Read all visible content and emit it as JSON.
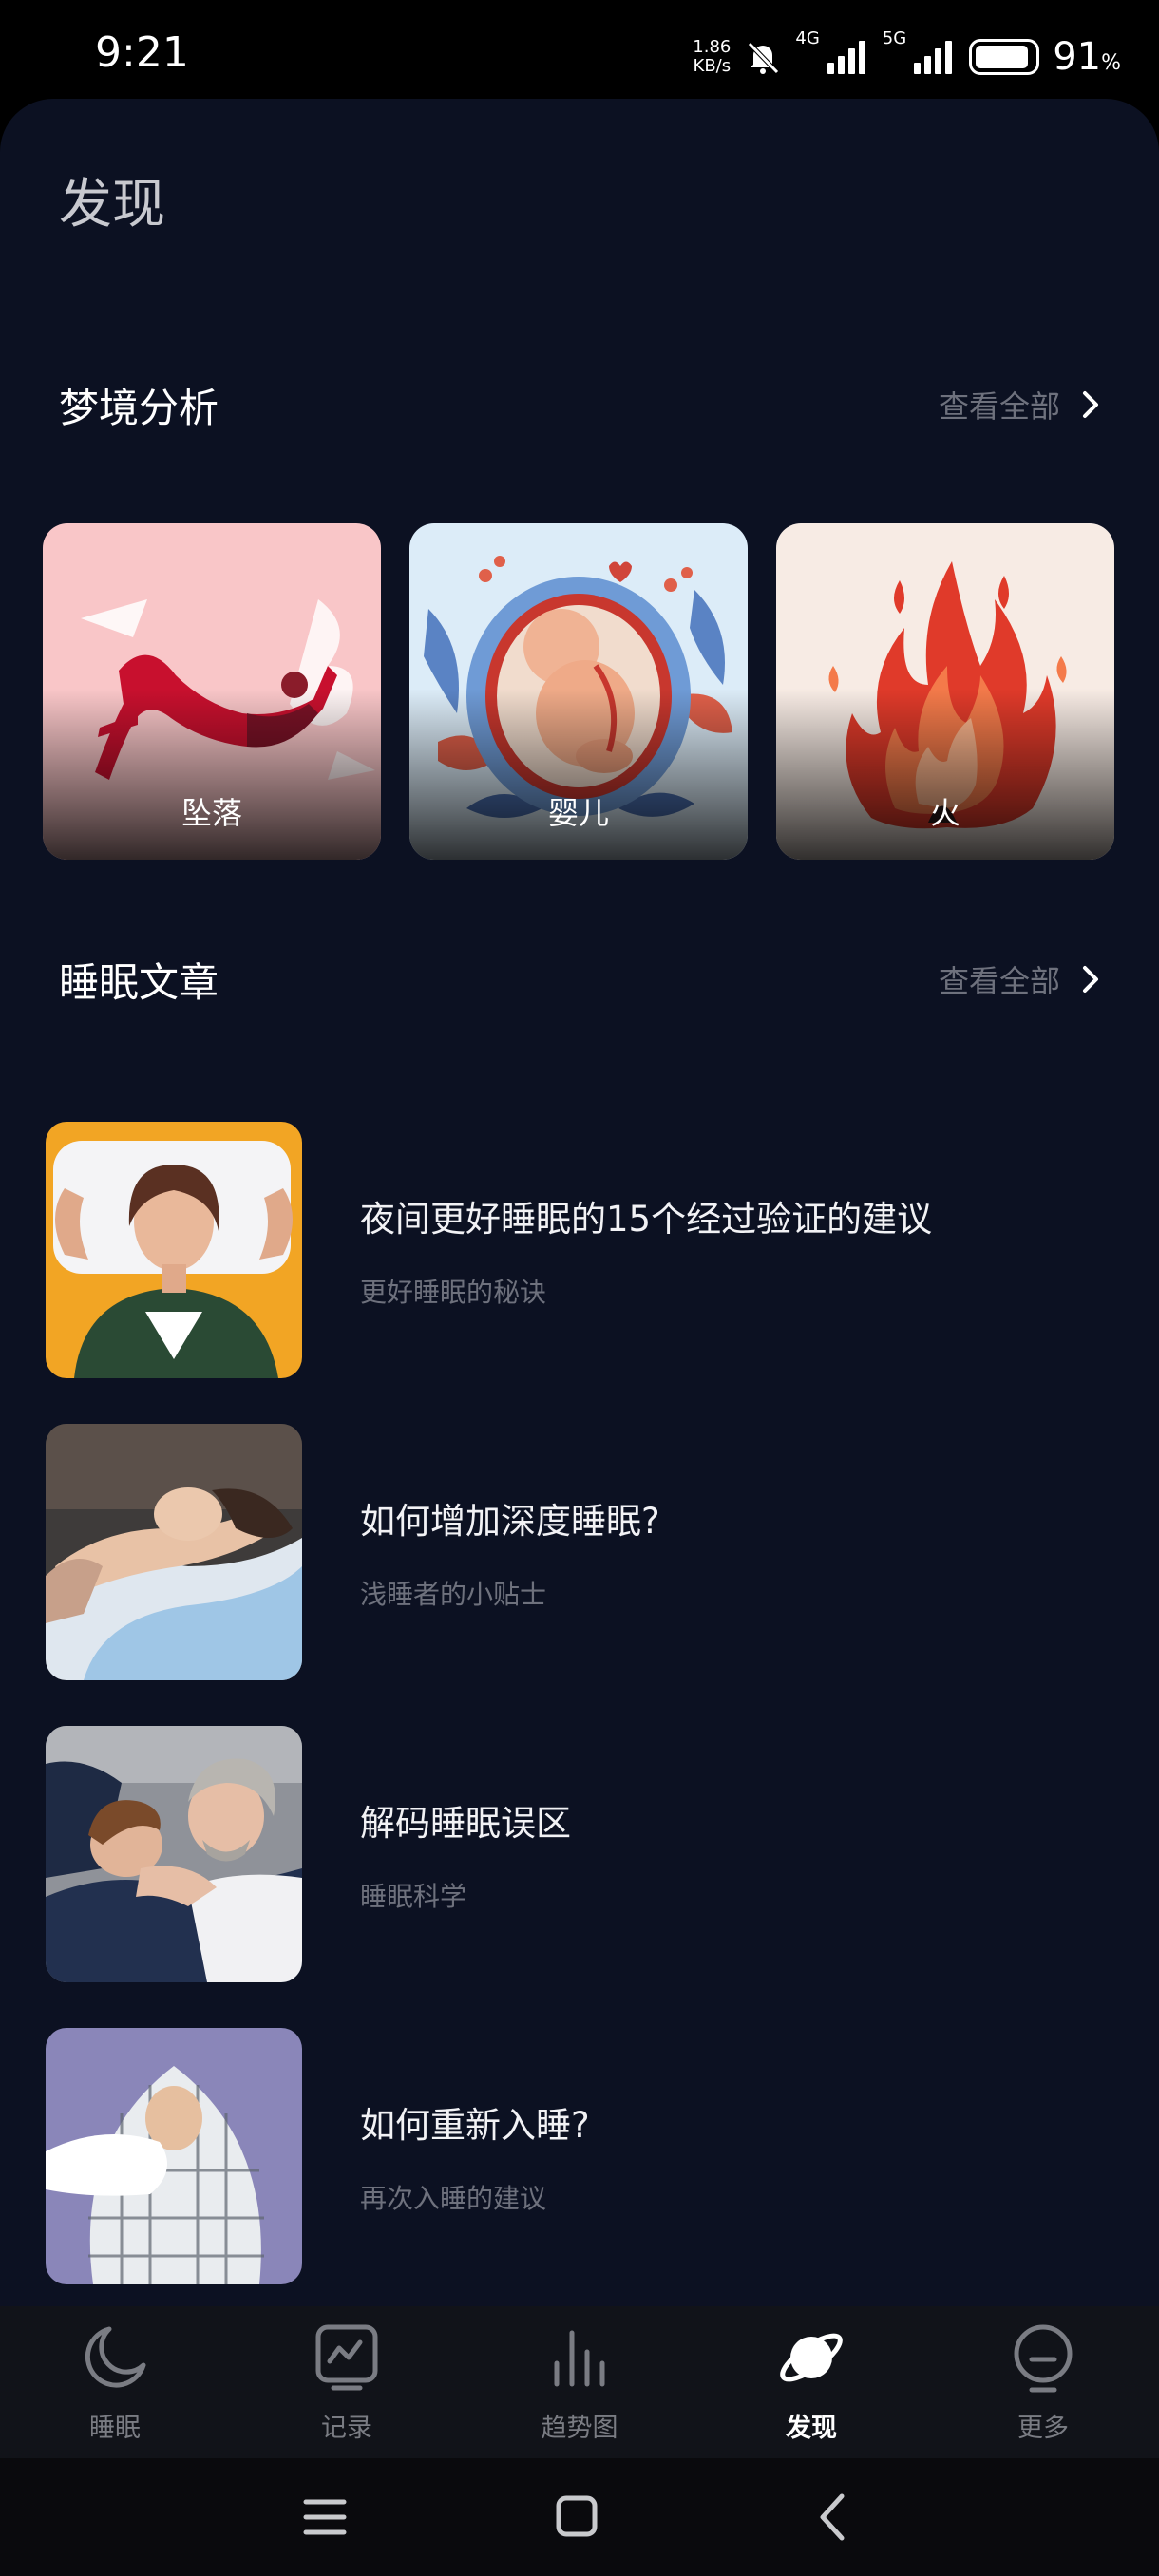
{
  "status_bar": {
    "time": "9:21",
    "net_speed_value": "1.86",
    "net_speed_unit": "KB/s",
    "signal1_label": "4G",
    "signal2_label": "5G",
    "battery_percent": "91",
    "battery_symbol": "%",
    "battery_level": 0.91
  },
  "page": {
    "title": "发现"
  },
  "dream_section": {
    "title": "梦境分析",
    "view_all": "查看全部",
    "cards": [
      {
        "label": "坠落",
        "image": "falling-woman-illustration"
      },
      {
        "label": "婴儿",
        "image": "baby-in-womb-illustration"
      },
      {
        "label": "火",
        "image": "fire-flames-illustration"
      }
    ]
  },
  "article_section": {
    "title": "睡眠文章",
    "view_all": "查看全部",
    "articles": [
      {
        "title": "夜间更好睡眠的15个经过验证的建议",
        "subtitle": "更好睡眠的秘诀",
        "image": "woman-with-pillow-photo"
      },
      {
        "title": "如何增加深度睡眠?",
        "subtitle": "浅睡者的小贴士",
        "image": "woman-sleeping-photo"
      },
      {
        "title": "解码睡眠误区",
        "subtitle": "睡眠科学",
        "image": "couple-sleeping-photo"
      },
      {
        "title": "如何重新入睡?",
        "subtitle": "再次入睡的建议",
        "image": "person-in-blanket-photo"
      }
    ]
  },
  "bottom_nav": {
    "items": [
      {
        "label": "睡眠",
        "icon": "moon-icon",
        "active": false
      },
      {
        "label": "记录",
        "icon": "chart-record-icon",
        "active": false
      },
      {
        "label": "趋势图",
        "icon": "bar-chart-icon",
        "active": false
      },
      {
        "label": "发现",
        "icon": "planet-icon",
        "active": true
      },
      {
        "label": "更多",
        "icon": "face-more-icon",
        "active": false
      }
    ]
  },
  "system_nav": {
    "buttons": [
      "menu-icon",
      "home-icon",
      "back-icon"
    ]
  },
  "colors": {
    "panel_background": "#0c1122",
    "accent_text": "#ffffff",
    "muted_text": "#6e717d",
    "nav_background": "#111319"
  }
}
